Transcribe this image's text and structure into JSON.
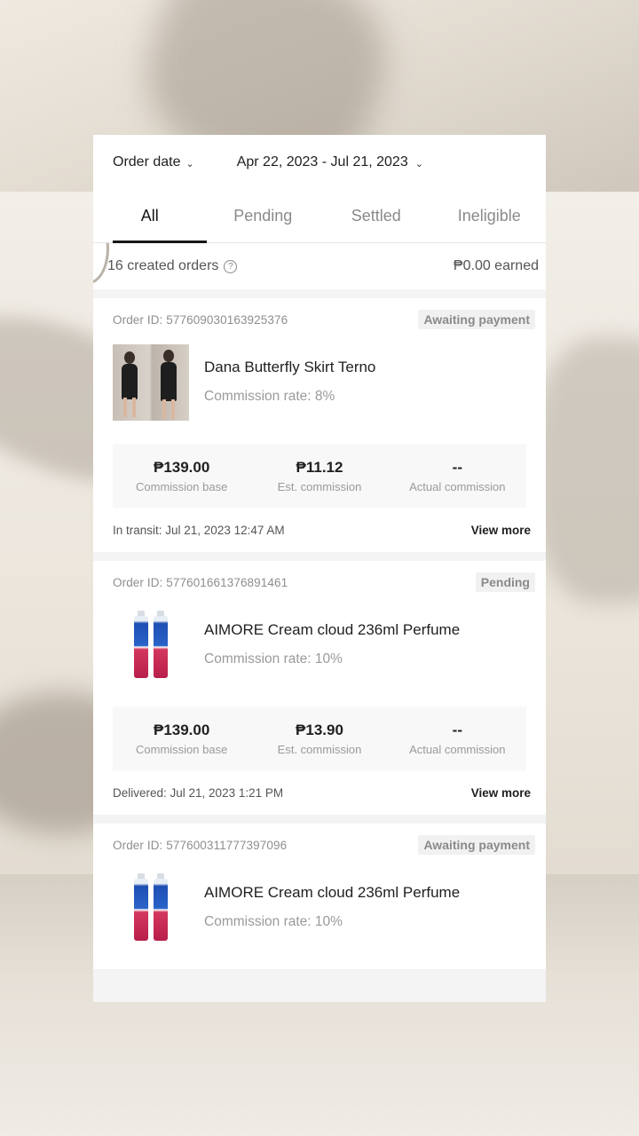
{
  "filters": {
    "order_date_label": "Order date",
    "date_range": "Apr 22, 2023 - Jul 21, 2023"
  },
  "tabs": [
    {
      "label": "All"
    },
    {
      "label": "Pending"
    },
    {
      "label": "Settled"
    },
    {
      "label": "Ineligible"
    }
  ],
  "summary": {
    "created_orders": "16 created orders",
    "earned": "₱0.00 earned"
  },
  "orders": [
    {
      "order_id": "Order ID: 577609030163925376",
      "status": "Awaiting payment",
      "product_name": "Dana Butterfly Skirt Terno",
      "commission_rate": "Commission rate: 8%",
      "commission_base": "₱139.00",
      "commission_base_label": "Commission base",
      "est_commission": "₱11.12",
      "est_commission_label": "Est. commission",
      "actual_commission": "--",
      "actual_commission_label": "Actual commission",
      "footer_status": "In transit: Jul 21, 2023 12:47 AM",
      "view_more": "View more"
    },
    {
      "order_id": "Order ID: 577601661376891461",
      "status": "Pending",
      "product_name": "AIMORE Cream cloud 236ml Perfume",
      "commission_rate": "Commission rate: 10%",
      "commission_base": "₱139.00",
      "commission_base_label": "Commission base",
      "est_commission": "₱13.90",
      "est_commission_label": "Est. commission",
      "actual_commission": "--",
      "actual_commission_label": "Actual commission",
      "footer_status": "Delivered: Jul 21, 2023 1:21 PM",
      "view_more": "View more"
    },
    {
      "order_id": "Order ID: 577600311777397096",
      "status": "Awaiting payment",
      "product_name": "AIMORE Cream cloud 236ml Perfume",
      "commission_rate": "Commission rate: 10%"
    }
  ],
  "icons": {
    "chevron": "chevron-down-icon",
    "help": "help-circle-icon"
  }
}
